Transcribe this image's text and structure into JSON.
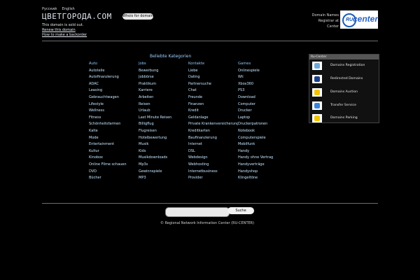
{
  "header": {
    "lang": [
      "Русский",
      "English"
    ],
    "logo_text": "ЦВЕТГОРОДА.COM",
    "whois_button": "Whois for domain",
    "sold_lines": [
      "This domain is sold out.",
      "Renew this domain",
      "How to make a backorder"
    ],
    "right_text": [
      "Domain Names",
      "Registrar at",
      "Center"
    ],
    "rucenter": {
      "badge": "RU",
      "word": "center"
    }
  },
  "categories": {
    "title": "Beliebte Kategorien",
    "headers": [
      "Auto",
      "Jobs",
      "Kontakte",
      "Games"
    ],
    "rows": [
      [
        "Autoteile",
        "Bewerbung",
        "Liebe",
        "Onlinespiele"
      ],
      [
        "Autofinanzierung",
        "Jobbörse",
        "Dating",
        "Wii"
      ],
      [
        "ADAC",
        "Praktikum",
        "Partnersuche",
        "Xbox360"
      ],
      [
        "Leasing",
        "Karriere",
        "Chat",
        "PS3"
      ],
      [
        "Gebrauchtwagen",
        "Arbeiten",
        "Freunde",
        "Download"
      ],
      [
        "Lifestyle",
        "Reisen",
        "Finanzen",
        "Computer"
      ],
      [
        "Wellness",
        "Urlaub",
        "Kredit",
        "Drucker"
      ],
      [
        "Fitness",
        "Last Minute Reisen",
        "Geldanlage",
        "Laptop"
      ],
      [
        "Schönheitsfarmen",
        "Billigflug",
        "Private Krankenversicherung",
        "Druckerpatronen"
      ],
      [
        "Kalte",
        "Flugreisen",
        "Kreditkarten",
        "Notebook"
      ],
      [
        "Mode",
        "Hotelbewertung",
        "Baufinanzierung",
        "Computerspiele"
      ],
      [
        "Entertainment",
        "Musik",
        "Internet",
        "Mobilfunk"
      ],
      [
        "Kultur",
        "Kids",
        "DSL",
        "Handy"
      ],
      [
        "Kinobox",
        "Musikdownloads",
        "Webdesign",
        "Handy ohne Vertrag"
      ],
      [
        "Online Filme schauen",
        "Mp3s",
        "Webhosting",
        "Handyverträge"
      ],
      [
        "DVD",
        "Gewinnspiele",
        "Internetbusiness",
        "Handyshop"
      ],
      [
        "Bücher",
        "MP3",
        "Provider",
        "Klingeltöne"
      ]
    ]
  },
  "panel": {
    "title": "Ru-Center",
    "items": [
      {
        "label": "Domains Registration",
        "icon": "globe-icon",
        "color": "#6fa9d8"
      },
      {
        "label": "Redirected Domains",
        "icon": "redirect-icon",
        "color": "#1d3f86"
      },
      {
        "label": "Domains Auction",
        "icon": "auction-icon",
        "color": "#f1c400"
      },
      {
        "label": "Transfer Service",
        "icon": "transfer-icon",
        "color": "#3a84d8"
      },
      {
        "label": "Domains Parking",
        "icon": "parking-icon",
        "color": "#f1c400"
      }
    ]
  },
  "search": {
    "placeholder": "",
    "button": "Suche"
  },
  "footer": "© Regional Network Information Center (RU-CENTER)"
}
